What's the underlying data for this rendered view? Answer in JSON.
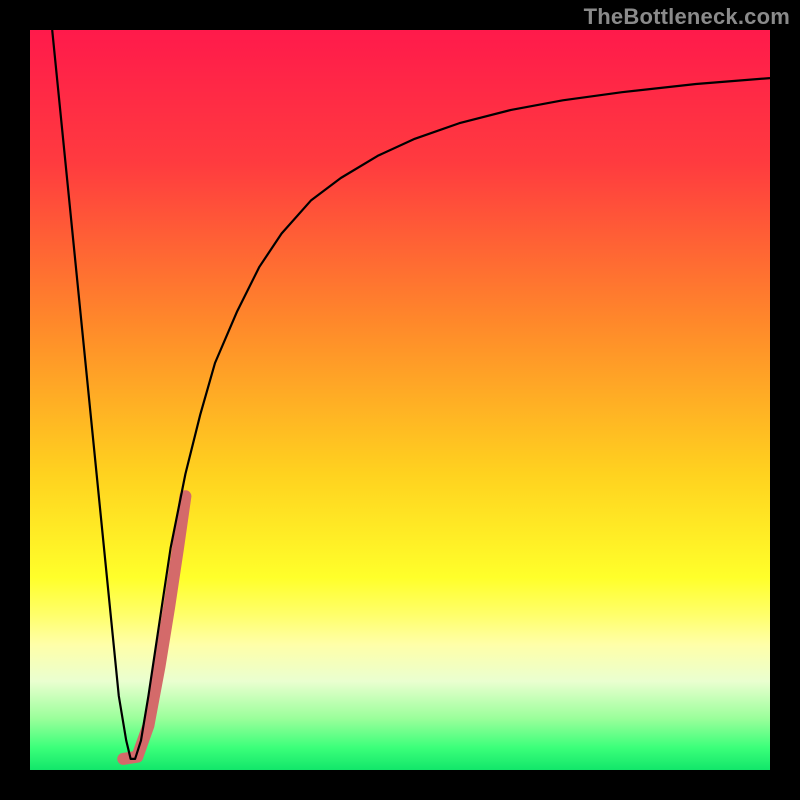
{
  "watermark": "TheBottleneck.com",
  "chart_data": {
    "type": "line",
    "title": "",
    "xlabel": "",
    "ylabel": "",
    "xlim": [
      0,
      100
    ],
    "ylim": [
      0,
      100
    ],
    "gradient_stops": [
      {
        "offset": 0,
        "color": "#ff1a4b"
      },
      {
        "offset": 18,
        "color": "#ff3b3f"
      },
      {
        "offset": 40,
        "color": "#ff8a2a"
      },
      {
        "offset": 60,
        "color": "#ffd21f"
      },
      {
        "offset": 74,
        "color": "#ffff2a"
      },
      {
        "offset": 79,
        "color": "#ffff6a"
      },
      {
        "offset": 83,
        "color": "#ffffa8"
      },
      {
        "offset": 88,
        "color": "#eaffd0"
      },
      {
        "offset": 93,
        "color": "#9bff9b"
      },
      {
        "offset": 97,
        "color": "#3bff7a"
      },
      {
        "offset": 100,
        "color": "#12e66a"
      }
    ],
    "series": [
      {
        "name": "curve",
        "color": "#000000",
        "stroke_width": 2.2,
        "x": [
          3.0,
          5.0,
          7.0,
          9.0,
          11.0,
          12.0,
          13.0,
          13.6,
          14.2,
          15.0,
          16.0,
          17.5,
          19.0,
          21.0,
          23.0,
          25.0,
          28.0,
          31.0,
          34.0,
          38.0,
          42.0,
          47.0,
          52.0,
          58.0,
          65.0,
          72.0,
          80.0,
          90.0,
          100.0
        ],
        "y": [
          100.0,
          80.0,
          60.0,
          40.0,
          20.0,
          10.0,
          4.0,
          1.5,
          1.5,
          4.0,
          10.0,
          20.0,
          30.0,
          40.0,
          48.0,
          55.0,
          62.0,
          68.0,
          72.5,
          77.0,
          80.0,
          83.0,
          85.3,
          87.4,
          89.2,
          90.5,
          91.6,
          92.7,
          93.5
        ]
      },
      {
        "name": "marker-segment",
        "color": "#d46a6a",
        "stroke_width": 12,
        "linecap": "round",
        "x": [
          12.6,
          14.5,
          16.0,
          17.5,
          18.8,
          20.0,
          21.0
        ],
        "y": [
          1.5,
          1.8,
          6.0,
          14.0,
          22.0,
          30.0,
          37.0
        ]
      }
    ]
  }
}
